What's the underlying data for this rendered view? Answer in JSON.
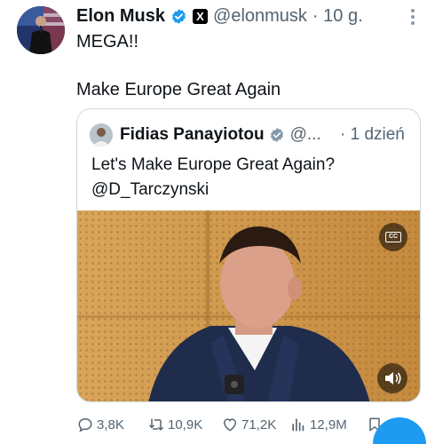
{
  "tweet": {
    "author_name": "Elon Musk",
    "author_handle": "@elonmusk",
    "time": "· 10 g.",
    "affiliation_badge": "X",
    "text_line1": "MEGA!!",
    "text_line2": "Make Europe Great Again"
  },
  "quote": {
    "author_name": "Fidias Panayiotou",
    "author_handle": "@...",
    "time": "· 1 dzień",
    "text_line1": "Let's Make Europe Great Again?",
    "text_line2": "@D_Tarczynski",
    "cc_label": "CC"
  },
  "actions": {
    "replies": "3,8K",
    "reposts": "10,9K",
    "likes": "71,2K",
    "views": "12,9M"
  },
  "colors": {
    "verified": "#1d9bf0",
    "accent": "#1d9bf0",
    "muted_text": "#536471",
    "border": "#cfd9de"
  },
  "icons": [
    "verified-badge-icon",
    "x-logo-icon",
    "more-icon",
    "captions-icon",
    "volume-icon",
    "reply-icon",
    "repost-icon",
    "like-icon",
    "views-icon",
    "bookmark-icon",
    "share-icon"
  ]
}
